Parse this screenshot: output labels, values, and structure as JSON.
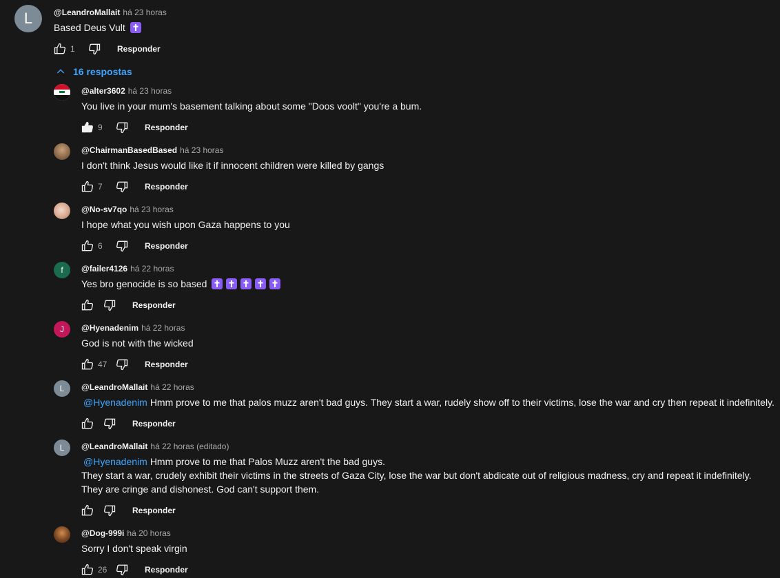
{
  "reply_label": "Responder",
  "colors": {
    "background": "#181818",
    "text": "#f1f1f1",
    "secondary": "#aaaaaa",
    "link": "#3ea6ff"
  },
  "root": {
    "author": "@LeandroMallait",
    "time": "há 23 horas",
    "avatar_letter": "L",
    "text": "Based Deus Vult",
    "emoji": "✝️",
    "likes": "1"
  },
  "replies_toggle": {
    "label": "16 respostas",
    "icon": "chevron-up-icon"
  },
  "replies": [
    {
      "author": "@alter3602",
      "time": "há 23 horas",
      "avatar": "iraq-flag",
      "text": "You live in your mum's basement talking about some \"Doos voolt\" you're a bum.",
      "likes": "9",
      "liked": true
    },
    {
      "author": "@ChairmanBasedBased",
      "time": "há 23 horas",
      "avatar": "photo",
      "text": "I don't think Jesus would like  it if innocent children were killed by gangs",
      "likes": "7"
    },
    {
      "author": "@No-sv7qo",
      "time": "há 23 horas",
      "avatar": "photo",
      "text": "I hope what you wish upon Gaza happens to you",
      "likes": "6"
    },
    {
      "author": "@failer4126",
      "time": "há 22 horas",
      "avatar_letter": "f",
      "text": "Yes bro genocide is so based",
      "emoji_count": 5,
      "likes": ""
    },
    {
      "author": "@Hyenadenim",
      "time": "há 22 horas",
      "avatar_letter": "J",
      "text": "God is not with the wicked",
      "likes": "47"
    },
    {
      "author": "@LeandroMallait",
      "time": "há 22 horas",
      "avatar_letter": "L",
      "mention": "@Hyenadenim",
      "text": "Hmm prove to me that palos muzz aren't bad guys. They start a war, rudely show off to their victims, lose the war and cry then repeat it indefinitely.",
      "likes": ""
    },
    {
      "author": "@LeandroMallait",
      "time": "há 22 horas (editado)",
      "avatar_letter": "L",
      "mention": "@Hyenadenim",
      "text": "Hmm prove to me that Palos Muzz aren't the bad guys.",
      "text_line2": "They start a war, crudely exhibit their victims in the streets of Gaza City, lose the war but don't abdicate out of religious madness, cry and repeat it indefinitely.",
      "text_line3": "They are cringe and dishonest. God can't support them.",
      "likes": ""
    },
    {
      "author": "@Dog-999i",
      "time": "há 20 horas",
      "avatar": "photo",
      "text": "Sorry I don't speak virgin",
      "likes": "26"
    }
  ]
}
